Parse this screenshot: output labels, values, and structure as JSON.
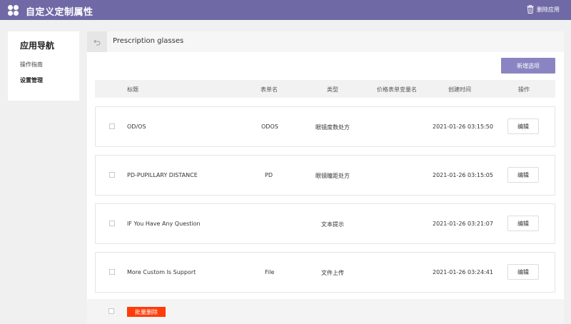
{
  "header": {
    "app_title": "自定义定制属性",
    "delete_app_label": "删除应用",
    "accent_color": "#6f6aa6"
  },
  "sidebar": {
    "title": "应用导航",
    "items": [
      {
        "label": "操作指南",
        "active": false
      },
      {
        "label": "设置管理",
        "active": true
      }
    ]
  },
  "main": {
    "title": "Prescription glasses",
    "add_button_label": "新增选项",
    "table": {
      "columns": [
        "标题",
        "表单名",
        "类型",
        "价格表单变量名",
        "创建时间",
        "操作"
      ],
      "rows": [
        {
          "title": "OD/OS",
          "form_name": "ODOS",
          "type": "眼镜度数处方",
          "price_var": "",
          "created": "2021-01-26 03:15:50",
          "action": "编辑"
        },
        {
          "title": "PD-PUPILLARY DISTANCE",
          "form_name": "PD",
          "type": "眼镜瞳距处方",
          "price_var": "",
          "created": "2021-01-26 03:15:05",
          "action": "编辑"
        },
        {
          "title": "IF You Have Any Question",
          "form_name": "",
          "type": "文本提示",
          "price_var": "",
          "created": "2021-01-26 03:21:07",
          "action": "编辑"
        },
        {
          "title": "More Custom Is Support",
          "form_name": "File",
          "type": "文件上传",
          "price_var": "",
          "created": "2021-01-26 03:24:41",
          "action": "编辑"
        }
      ]
    },
    "batch_delete_label": "批量删除"
  }
}
